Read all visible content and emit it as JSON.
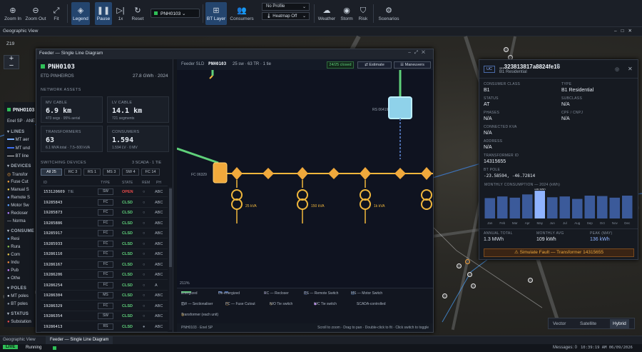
{
  "toolbar": {
    "zoom_in": "Zoom In",
    "zoom_out": "Zoom Out",
    "fit": "Fit",
    "legend": "Legend",
    "pause": "Pause",
    "speed": "1x",
    "reset": "Reset",
    "feeder": "PNH0103",
    "bt_layer": "BT Layer",
    "consumers": "Consumers",
    "profile": "No Profile",
    "heatmap": "Heatmap Off",
    "weather": "Weather",
    "storm": "Storm",
    "risk": "Risk",
    "scenarios": "Scenarios"
  },
  "geo_title": "Geographic View",
  "zoom_level": "Z19",
  "layers": {
    "feeder_name": "PNH0103",
    "feeder_sub": "Enel SP · ANE",
    "lines_h": "LINES",
    "lines": [
      "MT aer",
      "MT und",
      "BT line"
    ],
    "devices_h": "DEVICES",
    "devices": [
      "Transfor",
      "Fuse Cut",
      "Manual S",
      "Remote S",
      "Motor Sw",
      "Recloser",
      "— Norma"
    ],
    "consumers_h": "CONSUME",
    "consumers": [
      "Resi",
      "Rura",
      "Com",
      "Indu",
      "Pub",
      "Othe"
    ],
    "poles_h": "POLES",
    "poles": [
      "MT poles",
      "BT poles"
    ],
    "status_h": "STATUS",
    "status": [
      "Substation"
    ]
  },
  "sld": {
    "title": "Feeder — Single Line Diagram",
    "name": "PNH0103",
    "etd": "ETD PINHEIROS",
    "energy": "27.8 GWh · 2024",
    "network_h": "NETWORK ASSETS",
    "cards": [
      {
        "label": "MV CABLE",
        "value": "6.9 km",
        "sub": "473 segs · 95% aerial"
      },
      {
        "label": "LV CABLE",
        "value": "14.1 km",
        "sub": "721 segments"
      },
      {
        "label": "TRANSFORMERS",
        "value": "63",
        "sub": "6.1 MVA total · 7.5–500 kVA"
      },
      {
        "label": "CONSUMERS",
        "value": "1.594",
        "sub": "1.594 LV · 0 MV"
      }
    ],
    "switching_h": "SWITCHING DEVICES",
    "switching_meta": "3 SCADA · 1 TIE",
    "chips": [
      "All 25",
      "RC 3",
      "RS 1",
      "MS 3",
      "SW 4",
      "FC 14"
    ],
    "cols": [
      "ID",
      "TYPE",
      "STATE",
      "REM",
      "PH"
    ],
    "rows": [
      {
        "id": "153120609",
        "tie": "TIE",
        "type": "SW",
        "state": "OPEN",
        "rem": "○",
        "ph": "ABC"
      },
      {
        "id": "19285843",
        "type": "FC",
        "state": "CLSD",
        "rem": "○",
        "ph": "ABC"
      },
      {
        "id": "19285873",
        "type": "FC",
        "state": "CLSD",
        "rem": "○",
        "ph": "ABC"
      },
      {
        "id": "19285886",
        "type": "FC",
        "state": "CLSD",
        "rem": "○",
        "ph": "ABC"
      },
      {
        "id": "19285917",
        "type": "FC",
        "state": "CLSD",
        "rem": "○",
        "ph": "ABC"
      },
      {
        "id": "19285933",
        "type": "FC",
        "state": "CLSD",
        "rem": "○",
        "ph": "ABC"
      },
      {
        "id": "19286110",
        "type": "FC",
        "state": "CLSD",
        "rem": "○",
        "ph": "ABC"
      },
      {
        "id": "19286167",
        "type": "FC",
        "state": "CLSD",
        "rem": "○",
        "ph": "ABC"
      },
      {
        "id": "19286206",
        "type": "FC",
        "state": "CLSD",
        "rem": "○",
        "ph": "ABC"
      },
      {
        "id": "19286254",
        "type": "FC",
        "state": "CLSD",
        "rem": "○",
        "ph": "A"
      },
      {
        "id": "19286304",
        "type": "MS",
        "state": "CLSD",
        "rem": "○",
        "ph": "ABC"
      },
      {
        "id": "19286329",
        "type": "FC",
        "state": "CLSD",
        "rem": "○",
        "ph": "ABC"
      },
      {
        "id": "19286354",
        "type": "SW",
        "state": "CLSD",
        "rem": "○",
        "ph": "ABC"
      },
      {
        "id": "19286413",
        "type": "RS",
        "state": "CLSD",
        "rem": "●",
        "ph": "ABC"
      }
    ],
    "diagram_label": "Feeder SLD",
    "diagram_feeder": "PNH0103",
    "diagram_meta": "25 sw · 63 TR · 1 tie",
    "closed_badge": "24/25 closed",
    "estimate": "Estimate",
    "maneuvers": "Maneuvers",
    "rs_label": "RS 06419",
    "fc_label": "FC 06329",
    "t1": "25 kVA",
    "t2": "150 kVA",
    "t3": "1k kVA",
    "zoom_pct": "211%",
    "legend": {
      "energized": "Energized",
      "deenergized": "De-energized",
      "rc": "RC — Recloser",
      "rs": "RS — Remote Switch",
      "ms": "MS — Motor Switch",
      "sw": "SW — Sectionaliser",
      "fc": "FC — Fuse Cutout",
      "no_tie": "N/O Tie switch",
      "nc_tie": "N/C Tie switch",
      "scada": "SCADA-controlled",
      "transformer": "Transformer (each unit)"
    },
    "footer_left": "PNH0103 · Enel SP",
    "footer_right": "Scroll to zoom · Drag to pan · Double-click to fit · Click switch to toggle"
  },
  "detail": {
    "badge": "UC",
    "title": "...323813817a8824fe16",
    "subtitle": "B1 Residential",
    "fields": [
      {
        "k": "CONSUMER CLASS",
        "v": "B1"
      },
      {
        "k": "TYPE",
        "v": "B1 Residential"
      },
      {
        "k": "STATUS",
        "v": "AT"
      },
      {
        "k": "SUBCLASS",
        "v": "N/A"
      },
      {
        "k": "PHASES",
        "v": "N/A"
      },
      {
        "k": "CPF / CNPJ",
        "v": "N/A"
      },
      {
        "k": "CONNECTED KVA",
        "v": "N/A"
      },
      {
        "k": "ADDRESS",
        "v": "N/A"
      },
      {
        "k": "TRANSFORMER ID",
        "v": "14315655"
      },
      {
        "k": "BT POLE",
        "v": "-23.58594, -46.72814"
      }
    ],
    "monthly_h": "MONTHLY CONSUMPTION — 2024 (kWh)",
    "annual_k": "ANNUAL TOTAL",
    "annual_v": "1.3 MWh",
    "avg_k": "MONTHLY AVG",
    "avg_v": "109 kWh",
    "peak_k": "PEAK (MAY)",
    "peak_v": "136 kWh",
    "simulate": "Simulate Fault — Transformer 14315655"
  },
  "chart_data": {
    "type": "bar",
    "categories": [
      "Jan",
      "Feb",
      "Mar",
      "Apr",
      "May",
      "Jun",
      "Jul",
      "Aug",
      "Sep",
      "Oct",
      "Nov",
      "Dec"
    ],
    "values": [
      100,
      108,
      102,
      118,
      136,
      104,
      108,
      96,
      112,
      110,
      102,
      112
    ],
    "peak_label": "136 kWh",
    "title": "MONTHLY CONSUMPTION — 2024 (kWh)",
    "ylim": [
      0,
      140
    ]
  },
  "basemap": [
    "Vector",
    "Satellite",
    "Hybrid"
  ],
  "bottom_tabs": [
    "Geographic View",
    "Feeder — Single Line Diagram"
  ],
  "status": {
    "live": "LIVE",
    "running": "Running",
    "messages": "Messages: 0",
    "clock": "10:39:19 AM  06/09/2026"
  }
}
